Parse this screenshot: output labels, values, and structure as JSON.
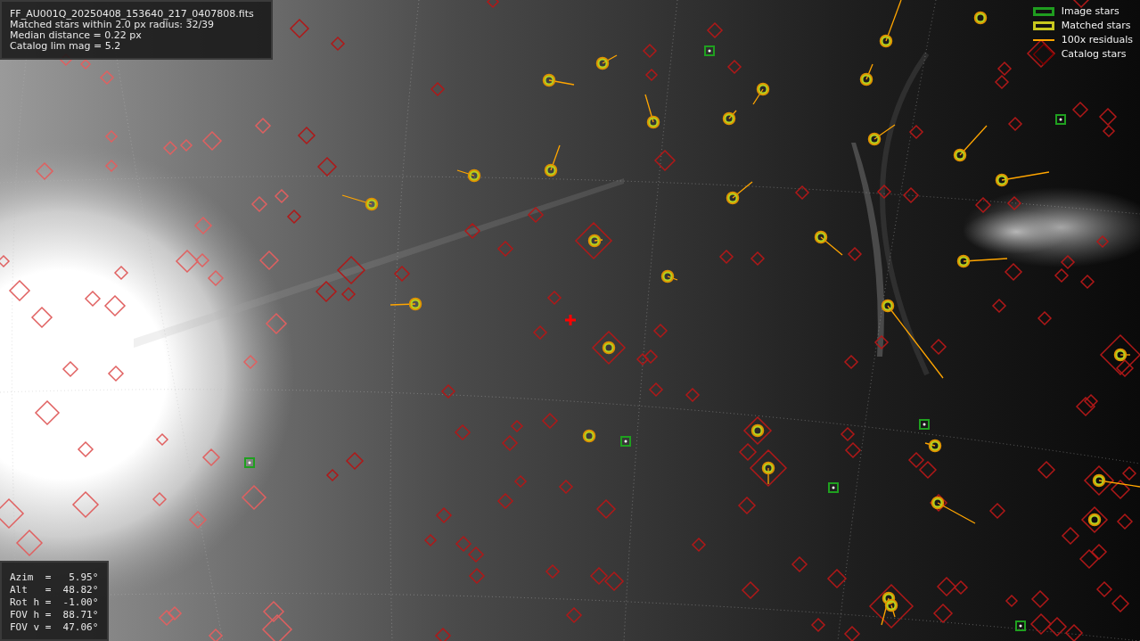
{
  "image_info": {
    "lines": [
      "FF_AU001Q_20250408_153640_217_0407808.fits",
      "Matched stars within 2.0 px radius: 32/39",
      "Median distance = 0.22 px",
      "Catalog lim mag = 5.2"
    ]
  },
  "legend": [
    {
      "label": "Image stars"
    },
    {
      "kind": "matched",
      "label": "Matched stars"
    },
    {
      "kind": "residual",
      "label": "100x residuals"
    },
    {
      "kind": "catalog",
      "label": "Catalog stars"
    }
  ],
  "pointing": {
    "lines": [
      "Azim  =   5.95°",
      "Alt   =  48.82°",
      "Rot h =  -1.00°",
      "FOV h =  88.71°",
      "FOV v =  47.06°"
    ]
  }
}
